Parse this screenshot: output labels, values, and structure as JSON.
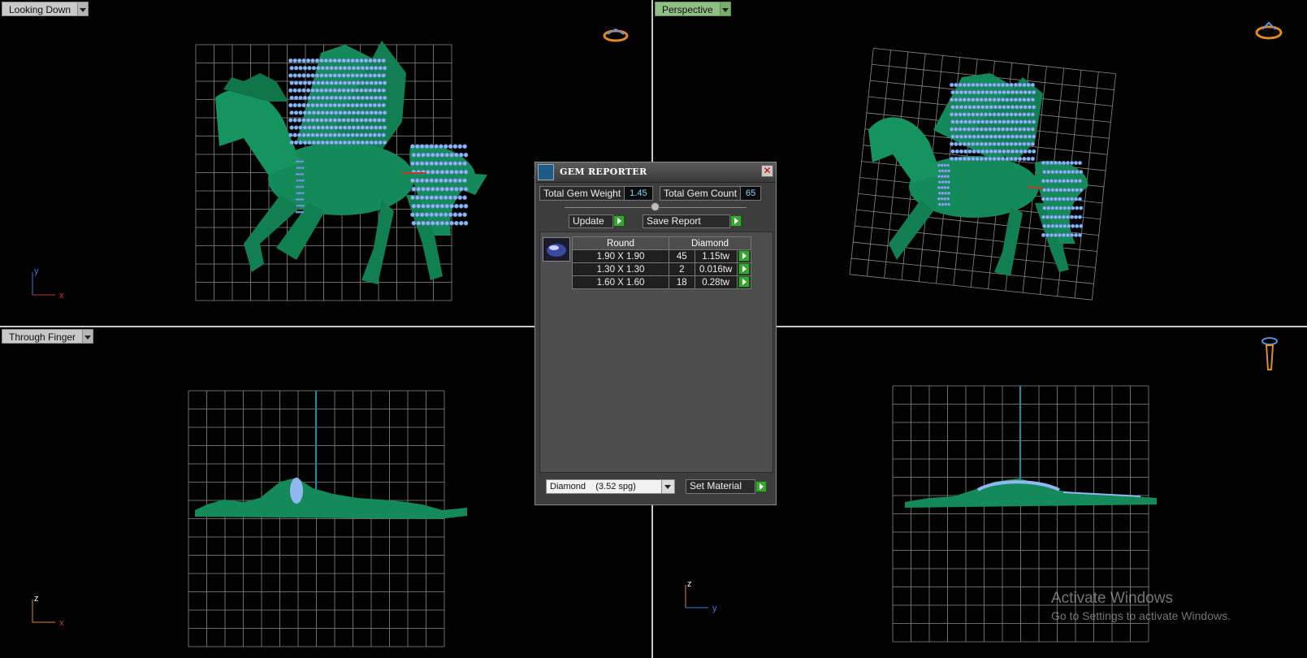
{
  "viewports": {
    "top_left": {
      "label": "Looking Down"
    },
    "top_right": {
      "label": "Perspective"
    },
    "bottom_left": {
      "label": "Through Finger"
    },
    "bottom_right": {
      "label": ""
    }
  },
  "axes": {
    "top_left": {
      "v": "y",
      "h": "x"
    },
    "bottom_left": {
      "v": "z",
      "h": "x"
    },
    "bottom_right": {
      "v": "z",
      "h": "y"
    }
  },
  "gem_reporter": {
    "title": "GEM REPORTER",
    "close_glyph": "✕",
    "total_weight_label": "Total Gem Weight",
    "total_weight_value": "1.45",
    "total_count_label": "Total Gem Count",
    "total_count_value": "65",
    "update_label": "Update",
    "save_report_label": "Save Report",
    "table": {
      "shape_header": "Round",
      "material_header": "Diamond",
      "rows": [
        {
          "size": "1.90 X 1.90",
          "count": "45",
          "weight": "1.15tw"
        },
        {
          "size": "1.30 X 1.30",
          "count": "2",
          "weight": "0.016tw"
        },
        {
          "size": "1.60 X 1.60",
          "count": "18",
          "weight": "0.28tw"
        }
      ]
    },
    "material_select": "Diamond    (3.52 spg)",
    "set_material_label": "Set Material"
  },
  "watermark": {
    "line1": "Activate Windows",
    "line2": "Go to Settings to activate Windows."
  },
  "colors": {
    "model_green": "#148a5a",
    "gem_blue": "#8fb8f0",
    "grid": "#8a8a8a",
    "z_axis": "#1a8fa0",
    "axis_red": "#c0392b",
    "axis_y": "#3b7bd6"
  },
  "icons": [
    "ring-view-icon",
    "close-icon",
    "gem-reporter-app-icon",
    "round-gem-icon",
    "play-arrow-icon",
    "chevron-down-icon"
  ]
}
